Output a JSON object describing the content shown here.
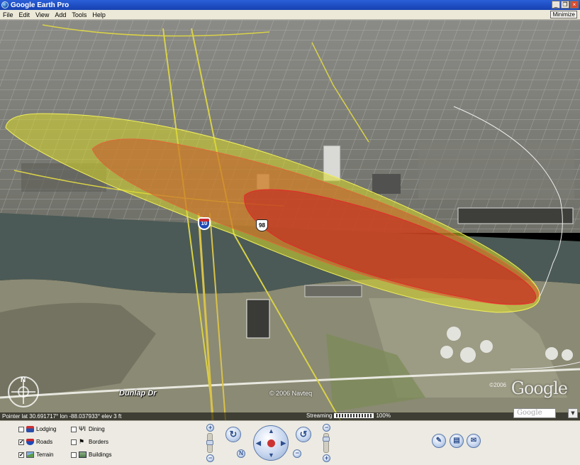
{
  "window": {
    "title": "Google Earth Pro",
    "minimize_label": "Minimize"
  },
  "menu": [
    "File",
    "Edit",
    "View",
    "Add",
    "Tools",
    "Help"
  ],
  "map": {
    "road_label": "Dunlap Dr",
    "shield_interstate": "10",
    "shield_us": "98",
    "data_copyright": "© 2006 Navteq",
    "imagery_copyright": "©2006",
    "logo": "Google",
    "compass_north": "N"
  },
  "status": {
    "pointer": "Pointer  lat   30.691717°   lon  -88.037933°  elev     3 ft",
    "streaming_label": "Streaming",
    "streaming_percent": "100%",
    "streaming_fraction": 1.0
  },
  "search": {
    "placeholder": "Google"
  },
  "layers": [
    {
      "label": "Lodging",
      "checked": false,
      "icon": "bed-icon"
    },
    {
      "label": "Roads",
      "checked": true,
      "icon": "road-shield-icon"
    },
    {
      "label": "Terrain",
      "checked": true,
      "icon": "mountain-icon"
    },
    {
      "label": "Dining",
      "checked": false,
      "icon": "fork-knife-icon"
    },
    {
      "label": "Borders",
      "checked": false,
      "icon": "flag-icon"
    },
    {
      "label": "Buildings",
      "checked": false,
      "icon": "building-icon"
    }
  ],
  "colors": {
    "plume_outer": "#d8d82a",
    "plume_middle": "#c9582a",
    "plume_inner": "#c8161c",
    "river": "#4b5a56",
    "panel": "#eceae2"
  }
}
